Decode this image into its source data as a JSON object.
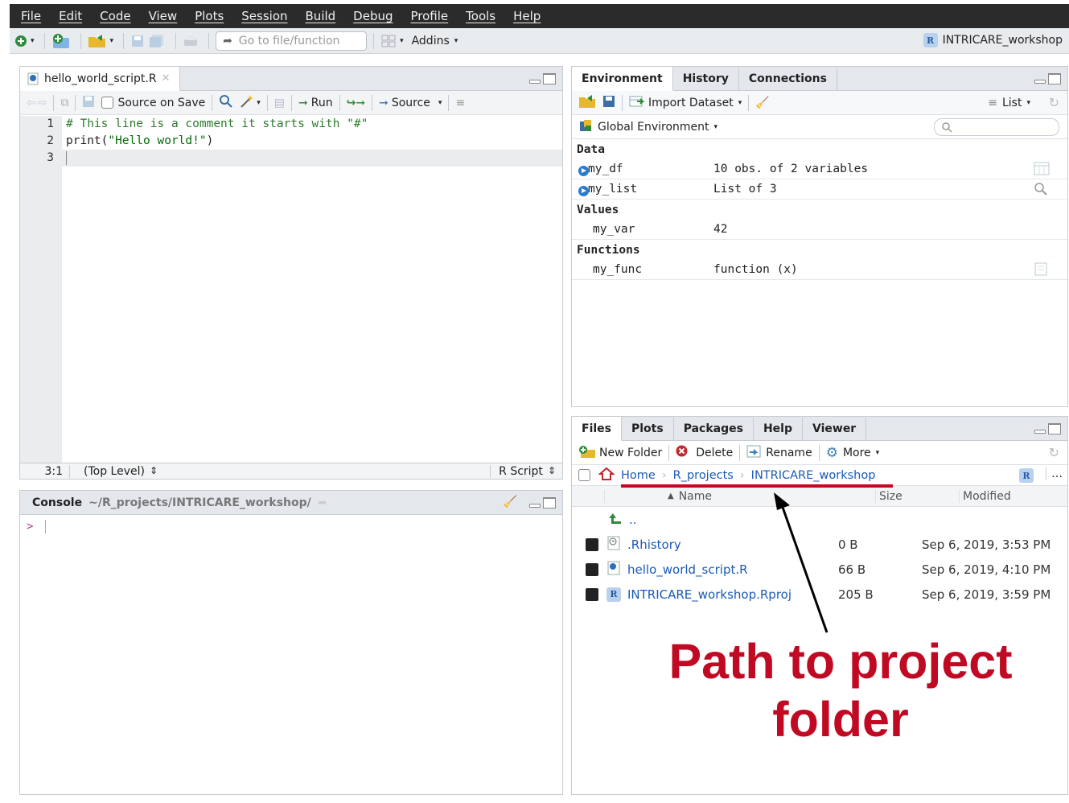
{
  "menu": [
    "File",
    "Edit",
    "Code",
    "View",
    "Plots",
    "Session",
    "Build",
    "Debug",
    "Profile",
    "Tools",
    "Help"
  ],
  "toolbar": {
    "goto_placeholder": "Go to file/function",
    "addins_label": "Addins",
    "project_name": "INTRICARE_workshop"
  },
  "editor": {
    "tab_label": "hello_world_script.R",
    "source_on_save_label": "Source on Save",
    "run_label": "Run",
    "source_label": "Source",
    "line_numbers": [
      "1",
      "2",
      "3"
    ],
    "line1": "# This line is a comment it starts with \"#\"",
    "line2_fn": "print(",
    "line2_str": "\"Hello world!\"",
    "line2_end": ")",
    "cursor_pos": "3:1",
    "scope": "(Top Level)",
    "file_type": "R Script"
  },
  "console": {
    "title": "Console",
    "path": "~/R_projects/INTRICARE_workshop/",
    "prompt": ">"
  },
  "env_pane": {
    "tabs": [
      "Environment",
      "History",
      "Connections"
    ],
    "import_label": "Import Dataset",
    "list_label": "List",
    "scope_label": "Global Environment",
    "sections": {
      "data": "Data",
      "values": "Values",
      "functions": "Functions"
    },
    "data_rows": [
      {
        "name": "my_df",
        "value": "10 obs. of 2 variables"
      },
      {
        "name": "my_list",
        "value": "List of 3"
      }
    ],
    "value_rows": [
      {
        "name": "my_var",
        "value": "42"
      }
    ],
    "function_rows": [
      {
        "name": "my_func",
        "value": "function (x)"
      }
    ]
  },
  "files_pane": {
    "tabs": [
      "Files",
      "Plots",
      "Packages",
      "Help",
      "Viewer"
    ],
    "new_folder_label": "New Folder",
    "delete_label": "Delete",
    "rename_label": "Rename",
    "more_label": "More",
    "breadcrumb": [
      "Home",
      "R_projects",
      "INTRICARE_workshop"
    ],
    "more_dots": "...",
    "columns": {
      "name": "Name",
      "size": "Size",
      "modified": "Modified"
    },
    "up_label": "..",
    "files": [
      {
        "name": ".Rhistory",
        "size": "0 B",
        "modified": "Sep 6, 2019, 3:53 PM"
      },
      {
        "name": "hello_world_script.R",
        "size": "66 B",
        "modified": "Sep 6, 2019, 4:10 PM"
      },
      {
        "name": "INTRICARE_workshop.Rproj",
        "size": "205 B",
        "modified": "Sep 6, 2019, 3:59 PM"
      }
    ]
  },
  "annotation": {
    "line1": "Path to project",
    "line2": "folder",
    "color": "#c00a23"
  }
}
